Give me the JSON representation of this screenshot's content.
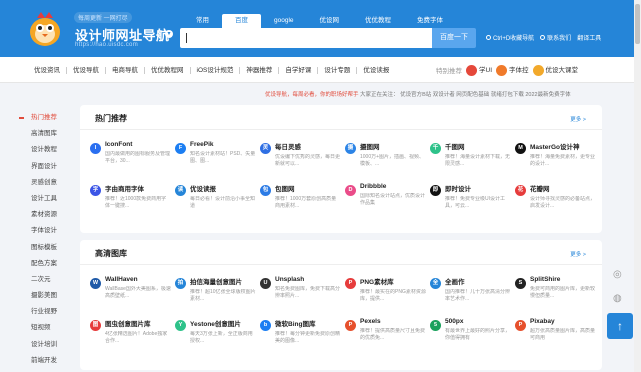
{
  "header": {
    "logo_small": "每周更新 一网打尽",
    "logo_title": "设计师网址导航",
    "logo_url": "https://hao.uisdc.com",
    "search_tabs": [
      {
        "label": "常用"
      },
      {
        "label": "百度"
      },
      {
        "label": "google"
      },
      {
        "label": "优设网"
      },
      {
        "label": "优优教程"
      },
      {
        "label": "免费字体"
      }
    ],
    "active_tab": "百度",
    "search_placeholder": "",
    "search_button": "百度一下",
    "links": [
      "Ctrl+D收藏导航",
      "联系我们",
      "翻译工具"
    ]
  },
  "nav": {
    "items": [
      "优设资讯",
      "优设导航",
      "电商导航",
      "优优教程网",
      "iOS设计规范",
      "神器推荐",
      "自学好课",
      "设计专题",
      "优设读报"
    ],
    "right_label": "特别推荐",
    "brands": [
      {
        "label": "学UI",
        "color": "#e5483a"
      },
      {
        "label": "字体控",
        "color": "#f07a2a"
      },
      {
        "label": "优设大课堂",
        "color": "#f2a92b"
      }
    ]
  },
  "notice": {
    "red": "优设导航，每周必看，你的职场好帮手",
    "rest": "大家正在关注：   优设官方B站   双设计者   网页配色基础   就绪打包下载   2022最新免费字体"
  },
  "sidebar": {
    "items": [
      "热门推荐",
      "高清图库",
      "设计教程",
      "界面设计",
      "灵感创意",
      "设计工具",
      "素材资源",
      "字体设计",
      "图标模板",
      "配色方案",
      "二次元",
      "摄影美图",
      "行业视野",
      "短视频",
      "设计培训",
      "前端开发"
    ]
  },
  "panels": [
    {
      "title": "热门推荐",
      "more": "更多 >",
      "sites": [
        {
          "name": "IconFont",
          "desc": "国内最做用的图标服务及管理平台，30...",
          "color": "#2a6ff0",
          "glyph": "I"
        },
        {
          "name": "FreePik",
          "desc": "知名设计素材站！PSD、矢量图、图...",
          "color": "#1c7ef2",
          "glyph": "F"
        },
        {
          "name": "每日灵感",
          "desc": "优设编下优秀的灵感，每日更新就可以...",
          "color": "#2f6fe3",
          "glyph": "灵"
        },
        {
          "name": "摄图网",
          "desc": "1000万+图片，插画、视频、模板、...",
          "color": "#2c84e6",
          "glyph": "摄"
        },
        {
          "name": "千图网",
          "desc": "推荐！海量设计素材下载，无限灵感...",
          "color": "#2ec28a",
          "glyph": "千"
        },
        {
          "name": "MasterGo设计神",
          "desc": "推荐！海量免费素材，更专业的设计...",
          "color": "#111111",
          "glyph": "M"
        },
        {
          "name": "字由商用字体",
          "desc": "推荐！近1000款免费商用字体一键搜...",
          "color": "#3b55e6",
          "glyph": "字"
        },
        {
          "name": "优设读报",
          "desc": "每日必看！设计前沿小事全知道",
          "color": "#2585d8",
          "glyph": "读"
        },
        {
          "name": "包图网",
          "desc": "推荐！1000万套原创高质量商用素材...",
          "color": "#2c7be5",
          "glyph": "包"
        },
        {
          "name": "Dribbble",
          "desc": "国际知名设计站点，优质设计作品集",
          "color": "#ea4c89",
          "glyph": "D"
        },
        {
          "name": "即时设计",
          "desc": "推荐！免费专业级UI设计工具，可云...",
          "color": "#111111",
          "glyph": "即"
        },
        {
          "name": "花瓣网",
          "desc": "设计师寻找灵感的必备站点，启发设计...",
          "color": "#e63c3c",
          "glyph": "花"
        }
      ]
    },
    {
      "title": "高清图库",
      "more": "更多 >",
      "sites": [
        {
          "name": "WallHaven",
          "desc": "WallBase国外大美图系，极速高质壁纸...",
          "color": "#1f5aa8",
          "glyph": "W"
        },
        {
          "name": "拍信海量创意图片",
          "desc": "推荐！超10亿张全球版权图片素材...",
          "color": "#2585d8",
          "glyph": "拍"
        },
        {
          "name": "Unsplash",
          "desc": "知名免费图库，免费下载高分辨率照片...",
          "color": "#333333",
          "glyph": "U"
        },
        {
          "name": "PNG素材库",
          "desc": "推荐！最实在的PNG素材资源库，提供...",
          "color": "#e63c3c",
          "glyph": "P"
        },
        {
          "name": "全画作",
          "desc": "国内推荐！几十万张高清分辨率艺术作...",
          "color": "#2585d8",
          "glyph": "全"
        },
        {
          "name": "SplitShire",
          "desc": "免费可商用的图片库，更新较慢但质量...",
          "color": "#222222",
          "glyph": "S"
        },
        {
          "name": "图虫创意图片库",
          "desc": "4亿张精选图片！Adobe独家合作...",
          "color": "#e63c3c",
          "glyph": "图"
        },
        {
          "name": "Yestone创意图片",
          "desc": "每天3万张上新，全正版商用授权...",
          "color": "#2ec28a",
          "glyph": "Y"
        },
        {
          "name": "微软Bing图库",
          "desc": "推荐！每分钟更新免费原创精美的图像...",
          "color": "#1c7ef2",
          "glyph": "b"
        },
        {
          "name": "Pexels",
          "desc": "推荐！提供高质量尺寸且免费的优质免...",
          "color": "#e6502c",
          "glyph": "P"
        },
        {
          "name": "500px",
          "desc": "有最世界上最好的照片分享，你值得拥有",
          "color": "#1aa15c",
          "glyph": "5"
        },
        {
          "name": "Pixabay",
          "desc": "超万张高质量图片库，高质量可商用",
          "color": "#e6502c",
          "glyph": "P"
        }
      ]
    }
  ],
  "float": {
    "top_label": "↑"
  }
}
